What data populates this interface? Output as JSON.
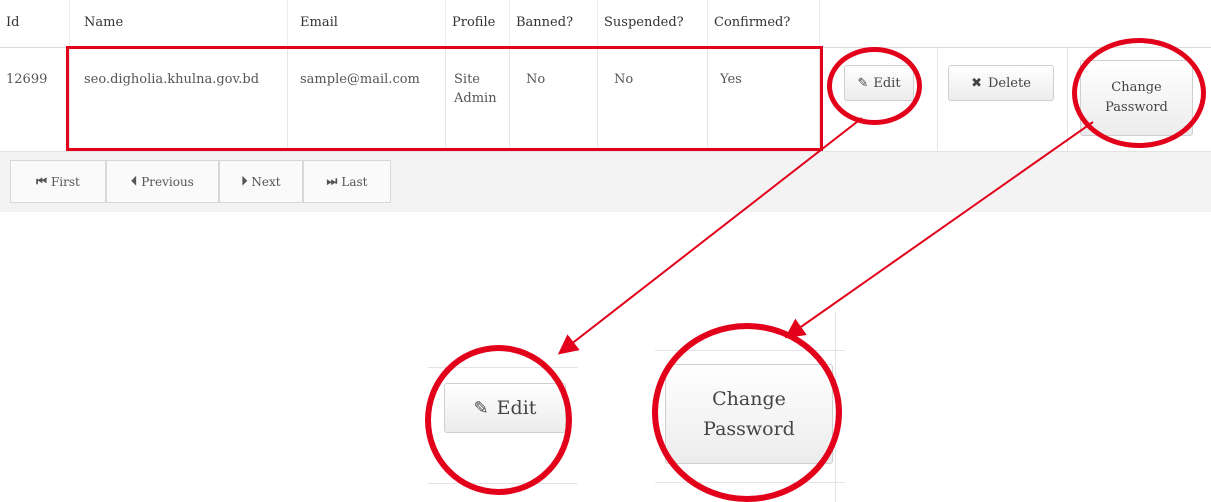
{
  "table": {
    "headers": [
      "Id",
      "Name",
      "Email",
      "Profile",
      "Banned?",
      "Suspended?",
      "Confirmed?"
    ],
    "row": {
      "id": "12699",
      "name": "seo.digholia.khulna.gov.bd",
      "email": "sample@mail.com",
      "profile_line1": "Site",
      "profile_line2": "Admin",
      "banned": "No",
      "suspended": "No",
      "confirmed": "Yes",
      "edit_label": "Edit",
      "delete_label": "Delete",
      "change_pw_line1": "Change",
      "change_pw_line2": "Password"
    }
  },
  "pagination": {
    "first": "First",
    "previous": "Previous",
    "next": "Next",
    "last": "Last"
  },
  "zoom": {
    "edit_label": "Edit",
    "change_pw_line1": "Change",
    "change_pw_line2": "Password"
  },
  "icons": {
    "edit": "pencil-icon",
    "delete": "times-icon",
    "first": "fast-backward-icon",
    "previous": "step-backward-icon",
    "next": "step-forward-icon",
    "last": "fast-forward-icon"
  },
  "colors": {
    "annotation": "#e2001a",
    "footer_bg": "#f3f3f3"
  }
}
